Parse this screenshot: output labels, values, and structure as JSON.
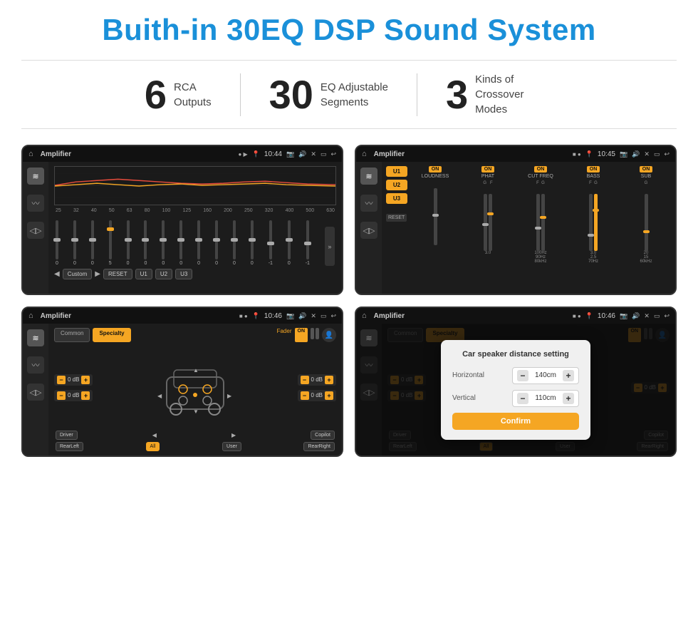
{
  "page": {
    "title": "Buith-in 30EQ DSP Sound System"
  },
  "stats": [
    {
      "number": "6",
      "text": "RCA\nOutputs"
    },
    {
      "number": "30",
      "text": "EQ Adjustable\nSegments"
    },
    {
      "number": "3",
      "text": "Kinds of\nCrossover Modes"
    }
  ],
  "screen1": {
    "app": "Amplifier",
    "time": "10:44",
    "eq_freqs": [
      "25",
      "32",
      "40",
      "50",
      "63",
      "80",
      "100",
      "125",
      "160",
      "200",
      "250",
      "320",
      "400",
      "500",
      "630"
    ],
    "eq_vals": [
      "0",
      "0",
      "0",
      "5",
      "0",
      "0",
      "0",
      "0",
      "0",
      "0",
      "0",
      "0",
      "-1",
      "0",
      "-1"
    ],
    "preset": "Custom",
    "buttons": [
      "RESET",
      "U1",
      "U2",
      "U3"
    ]
  },
  "screen2": {
    "app": "Amplifier",
    "time": "10:45",
    "presets": [
      "U1",
      "U2",
      "U3"
    ],
    "channels": [
      {
        "name": "LOUDNESS",
        "on": true
      },
      {
        "name": "PHAT",
        "on": true
      },
      {
        "name": "CUT FREQ",
        "on": true
      },
      {
        "name": "BASS",
        "on": true
      },
      {
        "name": "SUB",
        "on": true
      }
    ],
    "reset_label": "RESET"
  },
  "screen3": {
    "app": "Amplifier",
    "time": "10:46",
    "tabs": [
      "Common",
      "Specialty"
    ],
    "fader_label": "Fader",
    "fader_on": "ON",
    "zones": {
      "left_top": "0 dB",
      "left_bottom": "0 dB",
      "right_top": "0 dB",
      "right_bottom": "0 dB"
    },
    "bottom_btns": [
      "Driver",
      "",
      "Copilot",
      "RearLeft",
      "All",
      "User",
      "RearRight"
    ]
  },
  "screen4": {
    "app": "Amplifier",
    "time": "10:46",
    "dialog": {
      "title": "Car speaker distance setting",
      "horizontal_label": "Horizontal",
      "horizontal_value": "140cm",
      "vertical_label": "Vertical",
      "vertical_value": "110cm",
      "confirm_label": "Confirm"
    },
    "tabs": [
      "Common",
      "Specialty"
    ],
    "fader_on": "ON",
    "bottom_btns": [
      "Driver",
      "Copilot",
      "RearLeft",
      "User",
      "RearRight"
    ]
  }
}
